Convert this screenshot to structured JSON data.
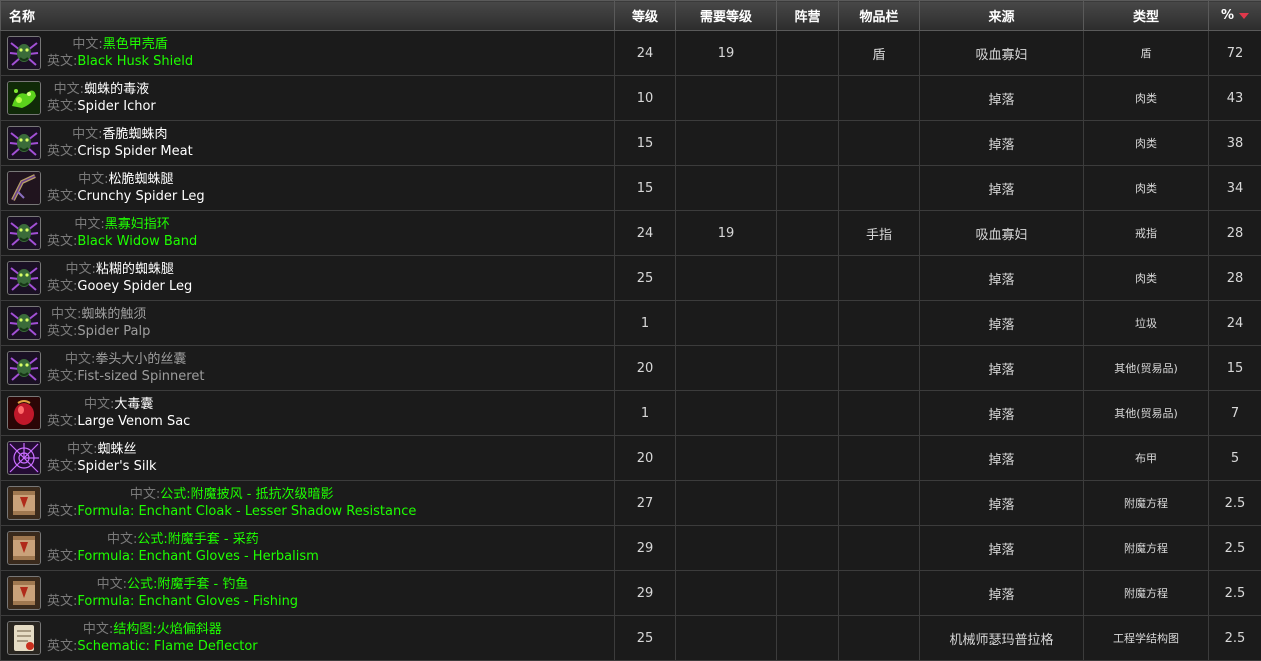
{
  "columns": {
    "name": "名称",
    "level": "等级",
    "req_level": "需要等级",
    "faction": "阵营",
    "slot": "物品栏",
    "source": "来源",
    "type": "类型",
    "pct": "%"
  },
  "labels": {
    "cn": "中文:",
    "en": "英文:"
  },
  "rows": [
    {
      "cn": "黑色甲壳盾",
      "en": "Black Husk Shield",
      "quality": "uncommon",
      "icon": "spider-head-icon",
      "level": "24",
      "req": "19",
      "faction": "",
      "slot": "盾",
      "source": "吸血寡妇",
      "type": "盾",
      "pct": "72"
    },
    {
      "cn": "蜘蛛的毒液",
      "en": "Spider Ichor",
      "quality": "common",
      "icon": "green-ichor-icon",
      "level": "10",
      "req": "",
      "faction": "",
      "slot": "",
      "source": "掉落",
      "type": "肉类",
      "pct": "43"
    },
    {
      "cn": "香脆蜘蛛肉",
      "en": "Crisp Spider Meat",
      "quality": "common",
      "icon": "spider-head-icon",
      "level": "15",
      "req": "",
      "faction": "",
      "slot": "",
      "source": "掉落",
      "type": "肉类",
      "pct": "38"
    },
    {
      "cn": "松脆蜘蛛腿",
      "en": "Crunchy Spider Leg",
      "quality": "common",
      "icon": "spider-leg-icon",
      "level": "15",
      "req": "",
      "faction": "",
      "slot": "",
      "source": "掉落",
      "type": "肉类",
      "pct": "34"
    },
    {
      "cn": "黑寡妇指环",
      "en": "Black Widow Band",
      "quality": "uncommon",
      "icon": "spider-head-icon",
      "level": "24",
      "req": "19",
      "faction": "",
      "slot": "手指",
      "source": "吸血寡妇",
      "type": "戒指",
      "pct": "28"
    },
    {
      "cn": "粘糊的蜘蛛腿",
      "en": "Gooey Spider Leg",
      "quality": "common",
      "icon": "spider-head-icon",
      "level": "25",
      "req": "",
      "faction": "",
      "slot": "",
      "source": "掉落",
      "type": "肉类",
      "pct": "28"
    },
    {
      "cn": "蜘蛛的触须",
      "en": "Spider Palp",
      "quality": "poor",
      "icon": "spider-head-icon",
      "level": "1",
      "req": "",
      "faction": "",
      "slot": "",
      "source": "掉落",
      "type": "垃圾",
      "pct": "24"
    },
    {
      "cn": "拳头大小的丝囊",
      "en": "Fist-sized Spinneret",
      "quality": "poor",
      "icon": "spider-head-icon",
      "level": "20",
      "req": "",
      "faction": "",
      "slot": "",
      "source": "掉落",
      "type": "其他(贸易品)",
      "pct": "15"
    },
    {
      "cn": "大毒囊",
      "en": "Large Venom Sac",
      "quality": "common",
      "icon": "venom-sac-icon",
      "level": "1",
      "req": "",
      "faction": "",
      "slot": "",
      "source": "掉落",
      "type": "其他(贸易品)",
      "pct": "7"
    },
    {
      "cn": "蜘蛛丝",
      "en": "Spider's Silk",
      "quality": "common",
      "icon": "spider-web-icon",
      "level": "20",
      "req": "",
      "faction": "",
      "slot": "",
      "source": "掉落",
      "type": "布甲",
      "pct": "5"
    },
    {
      "cn": "公式:附魔披风 - 抵抗次级暗影",
      "en": "Formula: Enchant Cloak - Lesser Shadow Resistance",
      "quality": "uncommon",
      "icon": "formula-scroll-icon",
      "level": "27",
      "req": "",
      "faction": "",
      "slot": "",
      "source": "掉落",
      "type": "附魔方程",
      "pct": "2.5"
    },
    {
      "cn": "公式:附魔手套 - 采药",
      "en": "Formula: Enchant Gloves - Herbalism",
      "quality": "uncommon",
      "icon": "formula-scroll-icon",
      "level": "29",
      "req": "",
      "faction": "",
      "slot": "",
      "source": "掉落",
      "type": "附魔方程",
      "pct": "2.5"
    },
    {
      "cn": "公式:附魔手套 - 钓鱼",
      "en": "Formula: Enchant Gloves - Fishing",
      "quality": "uncommon",
      "icon": "formula-scroll-icon",
      "level": "29",
      "req": "",
      "faction": "",
      "slot": "",
      "source": "掉落",
      "type": "附魔方程",
      "pct": "2.5"
    },
    {
      "cn": "结构图:火焰偏斜器",
      "en": "Schematic: Flame Deflector",
      "quality": "uncommon",
      "icon": "schematic-scroll-icon",
      "level": "25",
      "req": "",
      "faction": "",
      "slot": "",
      "source": "机械师瑟玛普拉格",
      "type": "工程学结构图",
      "pct": "2.5"
    }
  ],
  "colors": {
    "uncommon": "#1eff00",
    "common": "#ffffff",
    "poor": "#9d9d9d",
    "sort_arrow": "#e0384b"
  }
}
